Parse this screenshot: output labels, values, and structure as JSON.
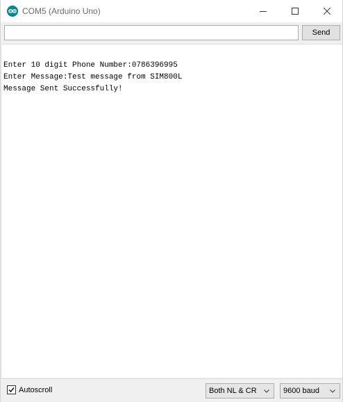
{
  "window": {
    "title": "COM5 (Arduino Uno)",
    "accent": "#00878f"
  },
  "controls": {
    "minimize_icon": "minimize-icon",
    "maximize_icon": "maximize-icon",
    "close_icon": "close-icon"
  },
  "send": {
    "input_value": "",
    "input_placeholder": "",
    "button_label": "Send"
  },
  "output": {
    "lines": [
      "Enter 10 digit Phone Number:0786396995",
      "Enter Message:Test message from SIM800L",
      "Message Sent Successfully!"
    ]
  },
  "bottom": {
    "autoscroll_label": "Autoscroll",
    "autoscroll_checked": true,
    "line_ending": "Both NL & CR",
    "baud_rate": "9600 baud"
  }
}
